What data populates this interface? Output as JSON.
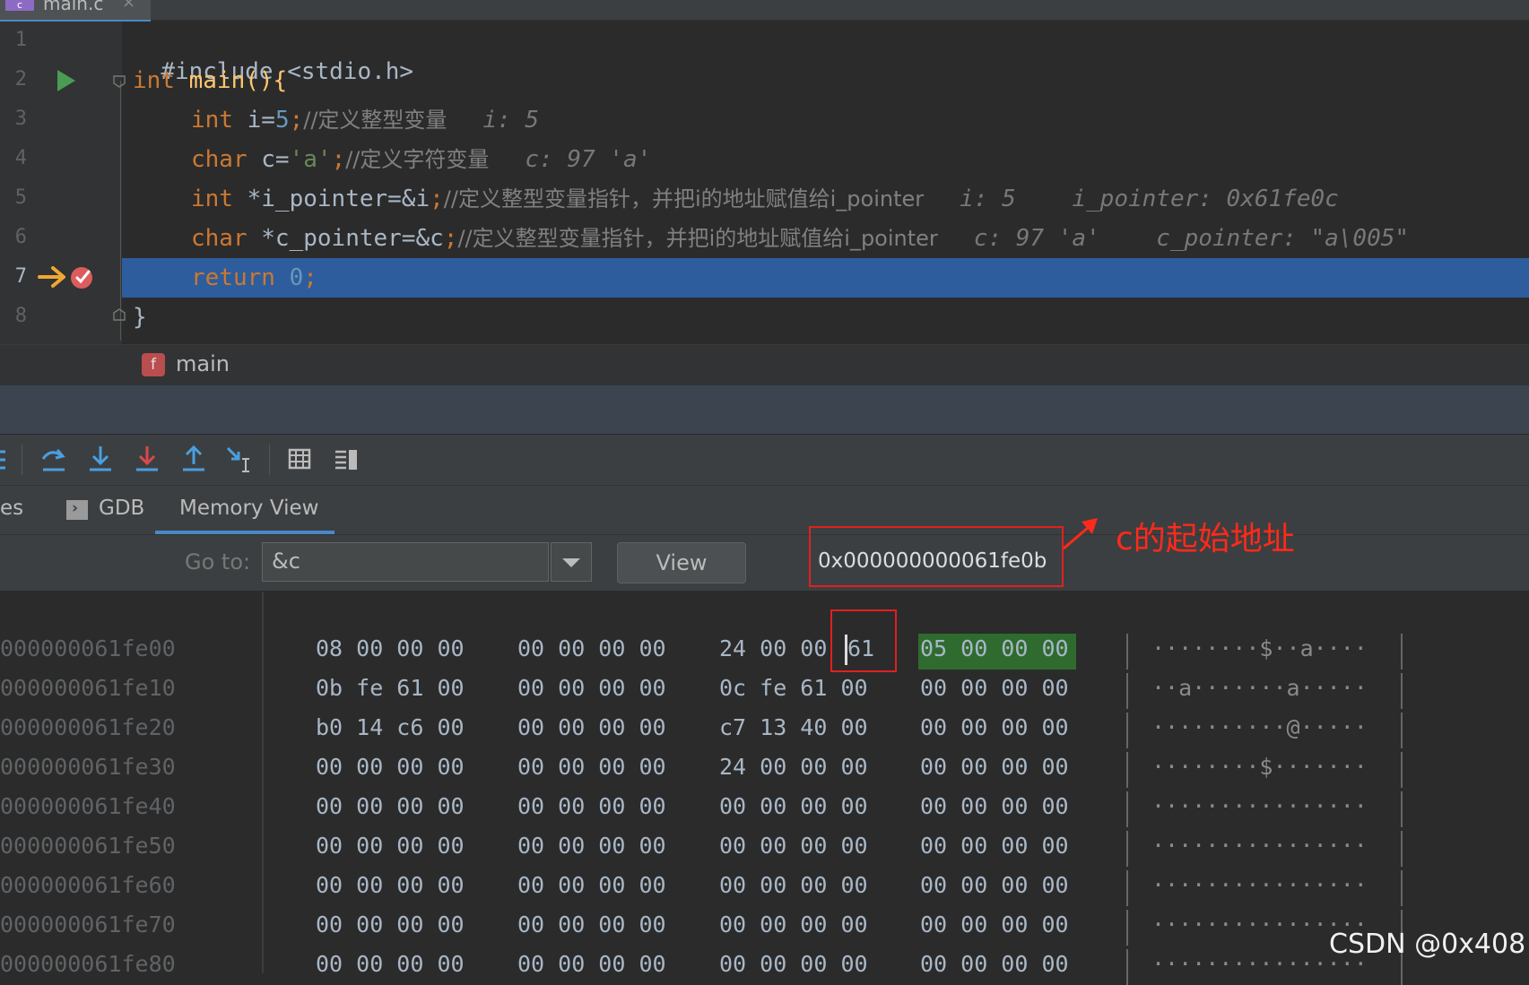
{
  "editor": {
    "file_tab": {
      "icon": "c-file-icon",
      "icon_text": "c",
      "name": "main.c",
      "close": "×"
    },
    "line_numbers": [
      "1",
      "2",
      "3",
      "4",
      "5",
      "6",
      "7",
      "8"
    ],
    "lines": {
      "l1": {
        "directive": "#include <stdio.h>"
      },
      "l2": {
        "kw": "int",
        "rest": " main(){"
      },
      "l3": {
        "kw": "int",
        "a": " i=",
        "num": "5",
        "b": ";",
        "comment": "//定义整型变量",
        "inline": "i: 5"
      },
      "l4": {
        "kw": "char",
        "a": " c=",
        "str": "'a'",
        "b": ";",
        "comment": "//定义字符变量",
        "inline": "c: 97 'a'"
      },
      "l5": {
        "kw": "int",
        "a": " *i_pointer=&i",
        "b": ";",
        "comment": "//定义整型变量指针，并把i的地址赋值给i_pointer",
        "inline": "i: 5    i_pointer: 0x61fe0c"
      },
      "l6": {
        "kw": "char",
        "a": " *c_pointer=&c",
        "b": ";",
        "comment": "//定义整型变量指针，并把i的地址赋值给i_pointer",
        "inline": "c: 97 'a'    c_pointer: \"a\\005\""
      },
      "l7": {
        "kw": "return",
        "num": " 0",
        "b": ";"
      },
      "l8": {
        "rest": "}"
      }
    },
    "current_line": 7
  },
  "breadcrumb": {
    "badge": "f",
    "function": "main"
  },
  "debug_toolbar": {
    "buttons": [
      "step-over-icon",
      "step-into-icon",
      "force-step-into-icon",
      "step-out-icon",
      "run-to-cursor-icon",
      "evaluate-expression-icon",
      "layout-icon"
    ]
  },
  "tabs": {
    "partial": "es",
    "gdb": "GDB",
    "memory_view": "Memory View",
    "active": "memory_view"
  },
  "goto": {
    "label": "Go to:",
    "value": "&c",
    "button": "View",
    "address": "0x000000000061fe0b"
  },
  "annotation": {
    "text": "c的起始地址",
    "color": "#ff2a1a"
  },
  "memory": {
    "rows": [
      {
        "addr": "000000061fe00",
        "g1": "08 00 00 00",
        "g2": "00 00 00 00",
        "g3a": "24 00 00 ",
        "g3b": "61",
        "g4": "05 00 00 00",
        "ascii": "········$··a····"
      },
      {
        "addr": "000000061fe10",
        "g1": "0b fe 61 00",
        "g2": "00 00 00 00",
        "g3a": "0c fe 61 00",
        "g3b": "",
        "g4": "00 00 00 00",
        "ascii": "··a·······a·····"
      },
      {
        "addr": "000000061fe20",
        "g1": "b0 14 c6 00",
        "g2": "00 00 00 00",
        "g3a": "c7 13 40 00",
        "g3b": "",
        "g4": "00 00 00 00",
        "ascii": "··········@·····"
      },
      {
        "addr": "000000061fe30",
        "g1": "00 00 00 00",
        "g2": "00 00 00 00",
        "g3a": "24 00 00 00",
        "g3b": "",
        "g4": "00 00 00 00",
        "ascii": "········$·······"
      },
      {
        "addr": "000000061fe40",
        "g1": "00 00 00 00",
        "g2": "00 00 00 00",
        "g3a": "00 00 00 00",
        "g3b": "",
        "g4": "00 00 00 00",
        "ascii": "················"
      },
      {
        "addr": "000000061fe50",
        "g1": "00 00 00 00",
        "g2": "00 00 00 00",
        "g3a": "00 00 00 00",
        "g3b": "",
        "g4": "00 00 00 00",
        "ascii": "················"
      },
      {
        "addr": "000000061fe60",
        "g1": "00 00 00 00",
        "g2": "00 00 00 00",
        "g3a": "00 00 00 00",
        "g3b": "",
        "g4": "00 00 00 00",
        "ascii": "················"
      },
      {
        "addr": "000000061fe70",
        "g1": "00 00 00 00",
        "g2": "00 00 00 00",
        "g3a": "00 00 00 00",
        "g3b": "",
        "g4": "00 00 00 00",
        "ascii": "················"
      },
      {
        "addr": "000000061fe80",
        "g1": "00 00 00 00",
        "g2": "00 00 00 00",
        "g3a": "00 00 00 00",
        "g3b": "",
        "g4": "00 00 00 00",
        "ascii": "················"
      }
    ]
  },
  "watermark": "CSDN @0x408"
}
